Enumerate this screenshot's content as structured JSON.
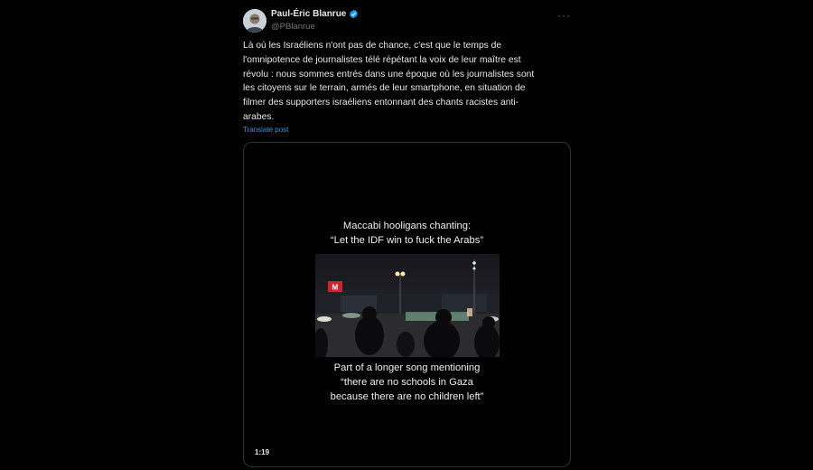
{
  "post": {
    "author_name": "Paul-Éric Blanrue",
    "author_handle": "@PBlanrue",
    "more_label": "···",
    "text_lines": [
      "Là où les Israéliens n'ont pas de chance, c'est que le temps de",
      "l'omnipotence de journalistes télé répétant la voix de leur maître est",
      "révolu : nous sommes entrés dans une époque où les journalistes sont",
      "les citoyens sur le terrain, armés de leur smartphone, en situation de",
      "filmer des supporters israéliens entonnant des chants racistes anti-",
      "arabes."
    ],
    "translate_label": "Translate post"
  },
  "media": {
    "caption_top": "Maccabi hooligans chanting:\n“Let the IDF win to fuck the Arabs”",
    "caption_bottom": "Part of a longer song mentioning\n“there are no schools in Gaza\nbecause there are no children left”",
    "duration": "1:19",
    "sign_text": "M"
  },
  "colors": {
    "background": "#000000",
    "text": "#e7e9ea",
    "secondary": "#71767b",
    "link": "#1d9bf0",
    "border": "#2f3336",
    "verified": "#1d9bf0"
  },
  "icons": {
    "verified": "verified-badge-icon",
    "more": "more-icon"
  }
}
